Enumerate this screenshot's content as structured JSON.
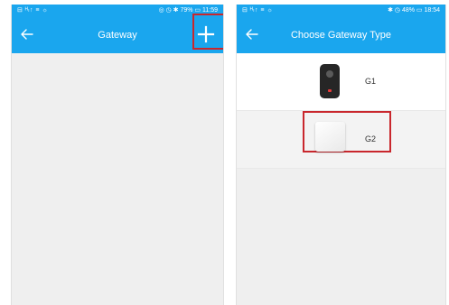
{
  "left_screen": {
    "status_bar": {
      "left_text": "⊟ ᴴₗ↑ ≡ ☼",
      "right_text": "◎ ◷ ✱ 79% ▭ 11:59"
    },
    "app_bar": {
      "title": "Gateway",
      "add_label": "+"
    }
  },
  "right_screen": {
    "status_bar": {
      "left_text": "⊟ ᴴₗ↑ ≡ ☼",
      "right_text": "✱ ◷ 48% ▭ 18:54"
    },
    "app_bar": {
      "title": "Choose Gateway Type"
    },
    "options": [
      {
        "label": "G1"
      },
      {
        "label": "G2"
      }
    ]
  },
  "colors": {
    "accent": "#1aa6ee",
    "highlight": "#c9272d",
    "background": "#efefef"
  },
  "icons": {
    "back": "arrow-left-icon",
    "add": "plus-icon"
  }
}
